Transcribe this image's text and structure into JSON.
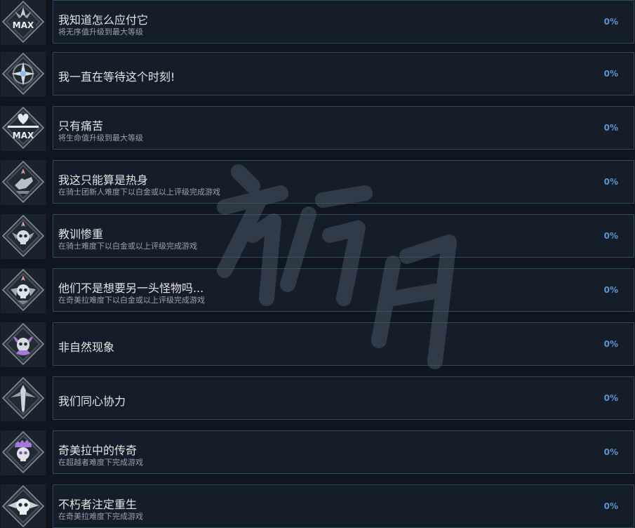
{
  "achievements": [
    {
      "title": "我知道怎么应付它",
      "description": "将无序值升级到最大等级",
      "percent": "0%",
      "icon": "max-badge-spiked-icon"
    },
    {
      "title": "我一直在等待这个时刻!",
      "description": "",
      "percent": "0%",
      "icon": "star-medallion-icon"
    },
    {
      "title": "只有痛苦",
      "description": "将生命值升级到最大等级",
      "percent": "0%",
      "icon": "max-badge-heart-icon"
    },
    {
      "title": "我这只能算是热身",
      "description": "在骑士团新人难度下以白金或以上评级完成游戏",
      "percent": "0%",
      "icon": "hand-sigil-icon"
    },
    {
      "title": "教训惨重",
      "description": "在骑士难度下以白金或以上评级完成游戏",
      "percent": "0%",
      "icon": "skull-sigil-icon"
    },
    {
      "title": "他们不是想要另一头怪物吗...",
      "description": "在奇美拉难度下以白金或以上评级完成游戏",
      "percent": "0%",
      "icon": "skull-crest-icon"
    },
    {
      "title": "非自然现象",
      "description": "",
      "percent": "0%",
      "icon": "purple-skull-icon"
    },
    {
      "title": "我们同心协力",
      "description": "",
      "percent": "0%",
      "icon": "sword-emblem-icon"
    },
    {
      "title": "奇美拉中的传奇",
      "description": "在超越者难度下完成游戏",
      "percent": "0%",
      "icon": "purple-flame-skull-icon"
    },
    {
      "title": "不朽者注定重生",
      "description": "在奇美拉难度下完成游戏",
      "percent": "0%",
      "icon": "winged-skull-icon"
    }
  ],
  "colors": {
    "background": "#0f1620",
    "panel": "#141d28",
    "panel_border": "#2b4b61",
    "percent": "#5c94d1",
    "title": "#e4e4e4",
    "description": "#9aa2ab",
    "icon_purple": "#a37ad8"
  }
}
